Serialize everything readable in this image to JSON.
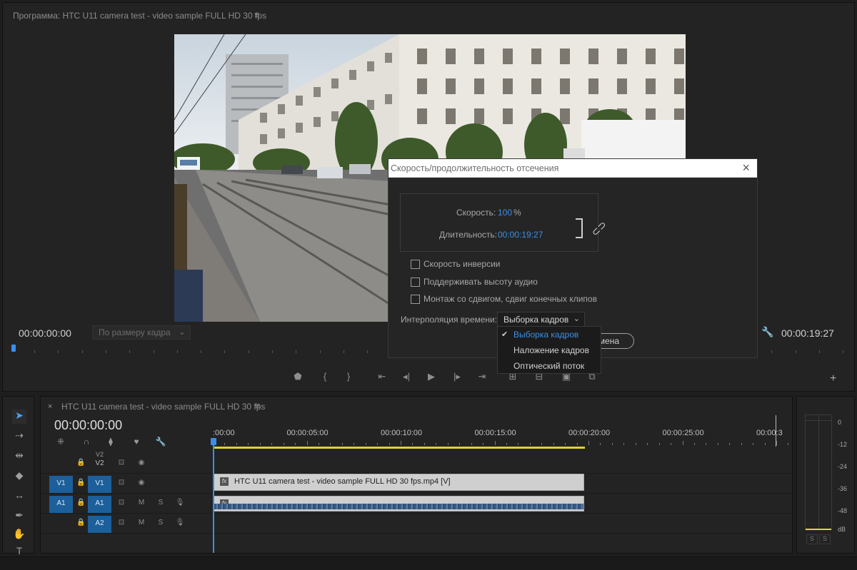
{
  "program_monitor": {
    "title": "Программа: HTC U11 camera test - video sample FULL HD 30 fps",
    "menu_glyph": "≡",
    "timecode_current": "00:00:00:00",
    "fit_label": "По размеру кадра",
    "timecode_duration": "00:00:19:27"
  },
  "dialog": {
    "title": "Скорость/продолжительность отсечения",
    "speed_label": "Скорость:",
    "speed_value": "100",
    "speed_unit": "%",
    "duration_label": "Длительность:",
    "duration_value": "00:00:19:27",
    "checkboxes": [
      {
        "label": "Скорость инверсии",
        "checked": false
      },
      {
        "label": "Поддерживать высоту аудио",
        "checked": false
      },
      {
        "label": "Монтаж со сдвигом, сдвиг конечных клипов",
        "checked": false
      }
    ],
    "interp_label": "Интерполяция времени:",
    "interp_value": "Выборка кадров",
    "cancel_partial": "мена"
  },
  "dropdown": {
    "options": [
      "Выборка кадров",
      "Наложение кадров",
      "Оптический поток"
    ],
    "selected_index": 0
  },
  "timeline": {
    "tab_title": "HTC U11 camera test - video sample FULL HD 30 fps",
    "close_glyph": "×",
    "menu_glyph": "≡",
    "timecode": "00:00:00:00",
    "ruler_labels": [
      ":00:00",
      "00:00:05:00",
      "00:00:10:00",
      "00:00:15:00",
      "00:00:20:00",
      "00:00:25:00",
      "00:00:3"
    ],
    "tracks": {
      "v2_partial": "V2",
      "v2": "V2",
      "v1_source": "V1",
      "v1": "V1",
      "a1_source": "A1",
      "a1": "A1",
      "a2": "A2",
      "mute": "M",
      "solo": "S"
    },
    "video_clip_name": "HTC U11 camera test - video sample FULL HD 30 fps.mp4 [V]",
    "fx_label": "fx"
  },
  "meter": {
    "db_labels": [
      "0",
      "-12",
      "-24",
      "-36",
      "-48",
      "dB"
    ],
    "solo_left": "S",
    "solo_right": "S"
  },
  "colors": {
    "accent_blue": "#3c8fe4",
    "work_area_yellow": "#e2d32a",
    "track_target_blue": "#1c5f9a"
  }
}
